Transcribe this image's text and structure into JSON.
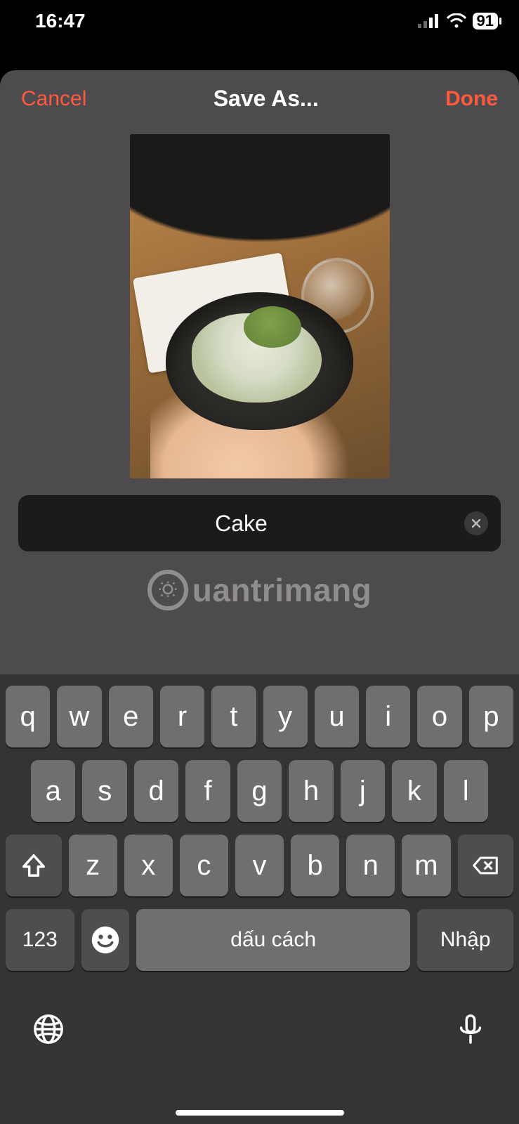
{
  "status": {
    "time": "16:47",
    "battery": "91"
  },
  "dialog": {
    "cancel_label": "Cancel",
    "title": "Save As...",
    "done_label": "Done"
  },
  "input": {
    "value": "Cake"
  },
  "watermark": {
    "text": "uantrimang"
  },
  "keyboard": {
    "row1": [
      "q",
      "w",
      "e",
      "r",
      "t",
      "y",
      "u",
      "i",
      "o",
      "p"
    ],
    "row2": [
      "a",
      "s",
      "d",
      "f",
      "g",
      "h",
      "j",
      "k",
      "l"
    ],
    "row3": [
      "z",
      "x",
      "c",
      "v",
      "b",
      "n",
      "m"
    ],
    "mode_label": "123",
    "space_label": "dấu cách",
    "enter_label": "Nhập"
  }
}
